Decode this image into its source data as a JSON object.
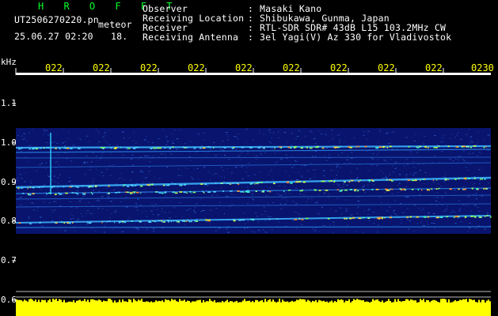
{
  "header": {
    "brand": "H R O F F T",
    "filename": "UT2506270220.pn",
    "mode": "meteor",
    "datetime": "25.06.27 02:20",
    "counter": "18.",
    "fields": [
      {
        "label": "Observer",
        "value": "Masaki Kano"
      },
      {
        "label": "Receiving Location",
        "value": "Shibukawa, Gunma, Japan"
      },
      {
        "label": "Receiver",
        "value": "RTL-SDR SDR# 43dB L15 103.2MHz CW"
      },
      {
        "label": "Receiving Antenna",
        "value": "3el Yagi(V) Az 330 for Vladivostok"
      }
    ]
  },
  "axis": {
    "y_unit": "kHz",
    "y_ticks": [
      "1.1",
      "1.0",
      "0.9",
      "0.8",
      "0.7",
      "0.6"
    ],
    "x_ticks": [
      "022",
      "022",
      "022",
      "022",
      "022",
      "022",
      "022",
      "022",
      "022",
      "0230"
    ]
  },
  "colors": {
    "background": "#000000",
    "spectrogram_bg": "#08146e",
    "brand": "#00ff2a",
    "text": "#ffffff",
    "time_labels": "#ffff00",
    "amplitude": "#ffff00"
  }
}
